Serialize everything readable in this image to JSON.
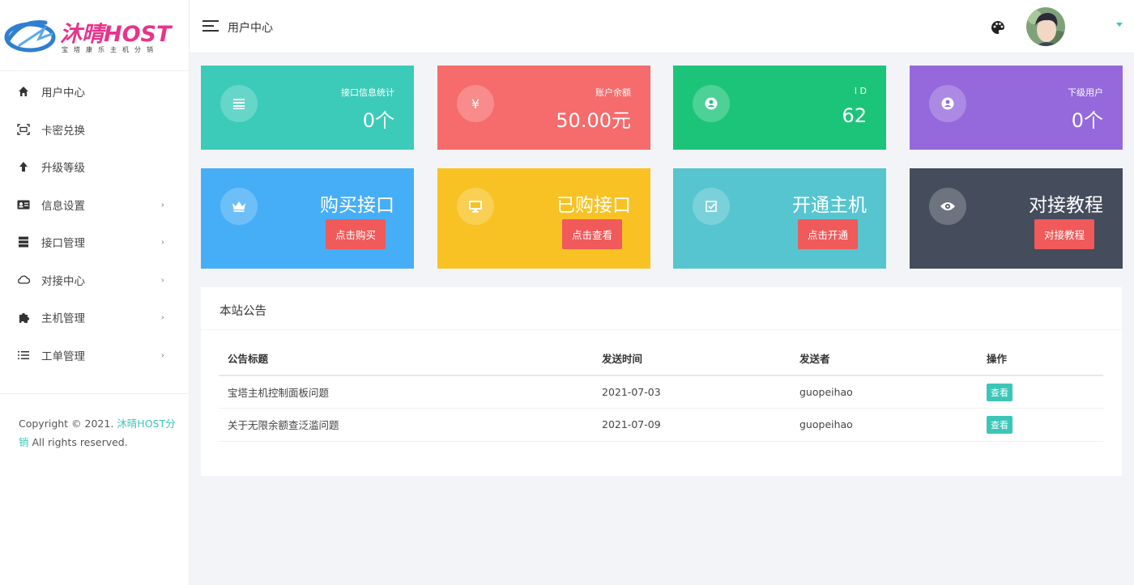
{
  "brand": {
    "name": "沐晴HOST",
    "tagline": "宝塔康乐主机分销"
  },
  "header": {
    "title": "用户中心"
  },
  "sidebar": {
    "items": [
      {
        "label": "用户中心",
        "icon": "home-icon",
        "chevron": false
      },
      {
        "label": "卡密兑换",
        "icon": "scan-icon",
        "chevron": false
      },
      {
        "label": "升级等级",
        "icon": "arrow-up-icon",
        "chevron": false
      },
      {
        "label": "信息设置",
        "icon": "id-card-icon",
        "chevron": true
      },
      {
        "label": "接口管理",
        "icon": "server-icon",
        "chevron": true
      },
      {
        "label": "对接中心",
        "icon": "cloud-icon",
        "chevron": true
      },
      {
        "label": "主机管理",
        "icon": "puzzle-icon",
        "chevron": true
      },
      {
        "label": "工单管理",
        "icon": "list-icon",
        "chevron": true
      }
    ],
    "chevron": "›"
  },
  "copyright": {
    "prefix": "Copyright © 2021. ",
    "brand": "沐晴HOST分销",
    "suffix": " All rights reserved."
  },
  "stats": [
    {
      "label": "接口信息统计",
      "value": "0个",
      "icon": "list-icon",
      "color": "#3ccbb9"
    },
    {
      "label": "账户余额",
      "value": "50.00元",
      "icon": "yen-icon",
      "color": "#f66b6b"
    },
    {
      "label": "I D",
      "value": "62",
      "icon": "user-circle-icon",
      "color": "#1cc47a"
    },
    {
      "label": "下级用户",
      "value": "0个",
      "icon": "user-circle-icon",
      "color": "#9569dc"
    }
  ],
  "actions": [
    {
      "title": "购买接口",
      "button": "点击购买",
      "icon": "crown-icon",
      "color": "#46aef6"
    },
    {
      "title": "已购接口",
      "button": "点击查看",
      "icon": "monitor-icon",
      "color": "#f8c224"
    },
    {
      "title": "开通主机",
      "button": "点击开通",
      "icon": "checklist-icon",
      "color": "#56c5d0"
    },
    {
      "title": "对接教程",
      "button": "对接教程",
      "icon": "eye-icon",
      "color": "#454c5c"
    }
  ],
  "announcements": {
    "title": "本站公告",
    "columns": [
      "公告标题",
      "发送时间",
      "发送者",
      "操作"
    ],
    "rows": [
      {
        "title": "宝塔主机控制面板问题",
        "time": "2021-07-03",
        "sender": "guopeihao",
        "action": "查看"
      },
      {
        "title": "关于无限余额查泛滥问题",
        "time": "2021-07-09",
        "sender": "guopeihao",
        "action": "查看"
      }
    ]
  },
  "colors": {
    "accent": "#3cc6b7",
    "cta": "#f05a5a",
    "brand": "#e8338c"
  }
}
